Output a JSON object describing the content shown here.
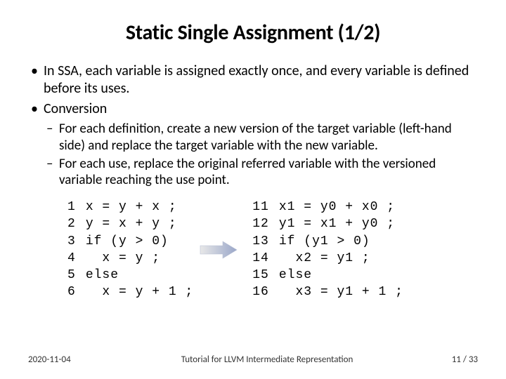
{
  "title": "Static Single Assignment (1/2)",
  "bullets": {
    "b1a": "In SSA, each variable is assigned exactly once, and every variable is defined before its uses.",
    "b1b": "Conversion",
    "b2a": "For each definition, create a new version of the target variable (left-hand side) and replace the target variable with the new variable.",
    "b2b": "For each use, replace the original referred variable with the versioned variable reaching the use point."
  },
  "code_left": {
    "nums": "1\n2\n3\n4\n5\n6",
    "src": "x = y + x ;\ny = x + y ;\nif (y > 0)\n  x = y ;\nelse\n  x = y + 1 ;"
  },
  "code_right": {
    "nums": "11\n12\n13\n14\n15\n16",
    "src": "x1 = y0 + x0 ;\ny1 = x1 + y0 ;\nif (y1 > 0)\n  x2 = y1 ;\nelse\n  x3 = y1 + 1 ;"
  },
  "footer": {
    "date": "2020-11-04",
    "mid": "Tutorial for LLVM Intermediate Representation",
    "page": "11",
    "sep": " / ",
    "total": "33"
  },
  "icons": {
    "arrow": "arrow-right"
  }
}
